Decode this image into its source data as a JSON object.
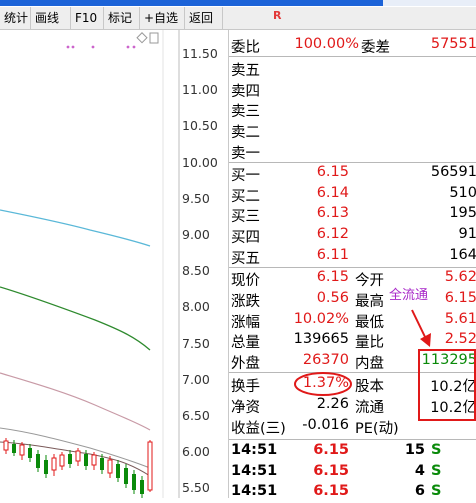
{
  "toolbar": {
    "items": [
      "统计",
      "画线",
      "F10",
      "标记",
      "+自选",
      "返回"
    ]
  },
  "header": {
    "marker": "R"
  },
  "price_axis": [
    "11.50",
    "11.00",
    "10.50",
    "10.00",
    "9.50",
    "9.00",
    "8.50",
    "8.00",
    "7.50",
    "7.00",
    "6.50",
    "6.00",
    "5.50"
  ],
  "quote": {
    "webi_label": "委比",
    "webi_value": "100.00%",
    "weicha_label": "委差",
    "weicha_value": "57551",
    "sell": [
      {
        "label": "卖五"
      },
      {
        "label": "卖四"
      },
      {
        "label": "卖三"
      },
      {
        "label": "卖二"
      },
      {
        "label": "卖一"
      }
    ],
    "buy": [
      {
        "label": "买一",
        "price": "6.15",
        "vol": "56591"
      },
      {
        "label": "买二",
        "price": "6.14",
        "vol": "510"
      },
      {
        "label": "买三",
        "price": "6.13",
        "vol": "195"
      },
      {
        "label": "买四",
        "price": "6.12",
        "vol": "91"
      },
      {
        "label": "买五",
        "price": "6.11",
        "vol": "164"
      }
    ],
    "stats": [
      {
        "l1": "现价",
        "v1": "6.15",
        "l2": "今开",
        "v2": "5.62"
      },
      {
        "l1": "涨跌",
        "v1": "0.56",
        "l2": "最高",
        "v2": "6.15"
      },
      {
        "l1": "涨幅",
        "v1": "10.02%",
        "l2": "最低",
        "v2": "5.61"
      },
      {
        "l1": "总量",
        "v1": "139665",
        "l2": "量比",
        "v2": "2.52"
      },
      {
        "l1": "外盘",
        "v1": "26370",
        "l2": "内盘",
        "v2": "113295"
      }
    ],
    "stats2": [
      {
        "l1": "换手",
        "v1": "1.37%",
        "l2": "股本",
        "v2": "10.2亿"
      },
      {
        "l1": "净资",
        "v1": "2.26",
        "l2": "流通",
        "v2": "10.2亿"
      },
      {
        "l1": "收益(三)",
        "v1": "-0.016",
        "l2": "PE(动)",
        "v2": ""
      }
    ],
    "ticks": [
      {
        "time": "14:51",
        "price": "6.15",
        "vol": "15",
        "side": "S"
      },
      {
        "time": "14:51",
        "price": "6.15",
        "vol": "4",
        "side": "S"
      },
      {
        "time": "14:51",
        "price": "6.15",
        "vol": "6",
        "side": "S"
      }
    ]
  },
  "annotation": {
    "text": "全流通"
  },
  "colors": {
    "up": "#e01919",
    "down": "#0a8a0a",
    "ma_cyan": "#5ab8d8",
    "ma_green": "#2e8a2e",
    "ma_pink": "#c89aa6"
  }
}
